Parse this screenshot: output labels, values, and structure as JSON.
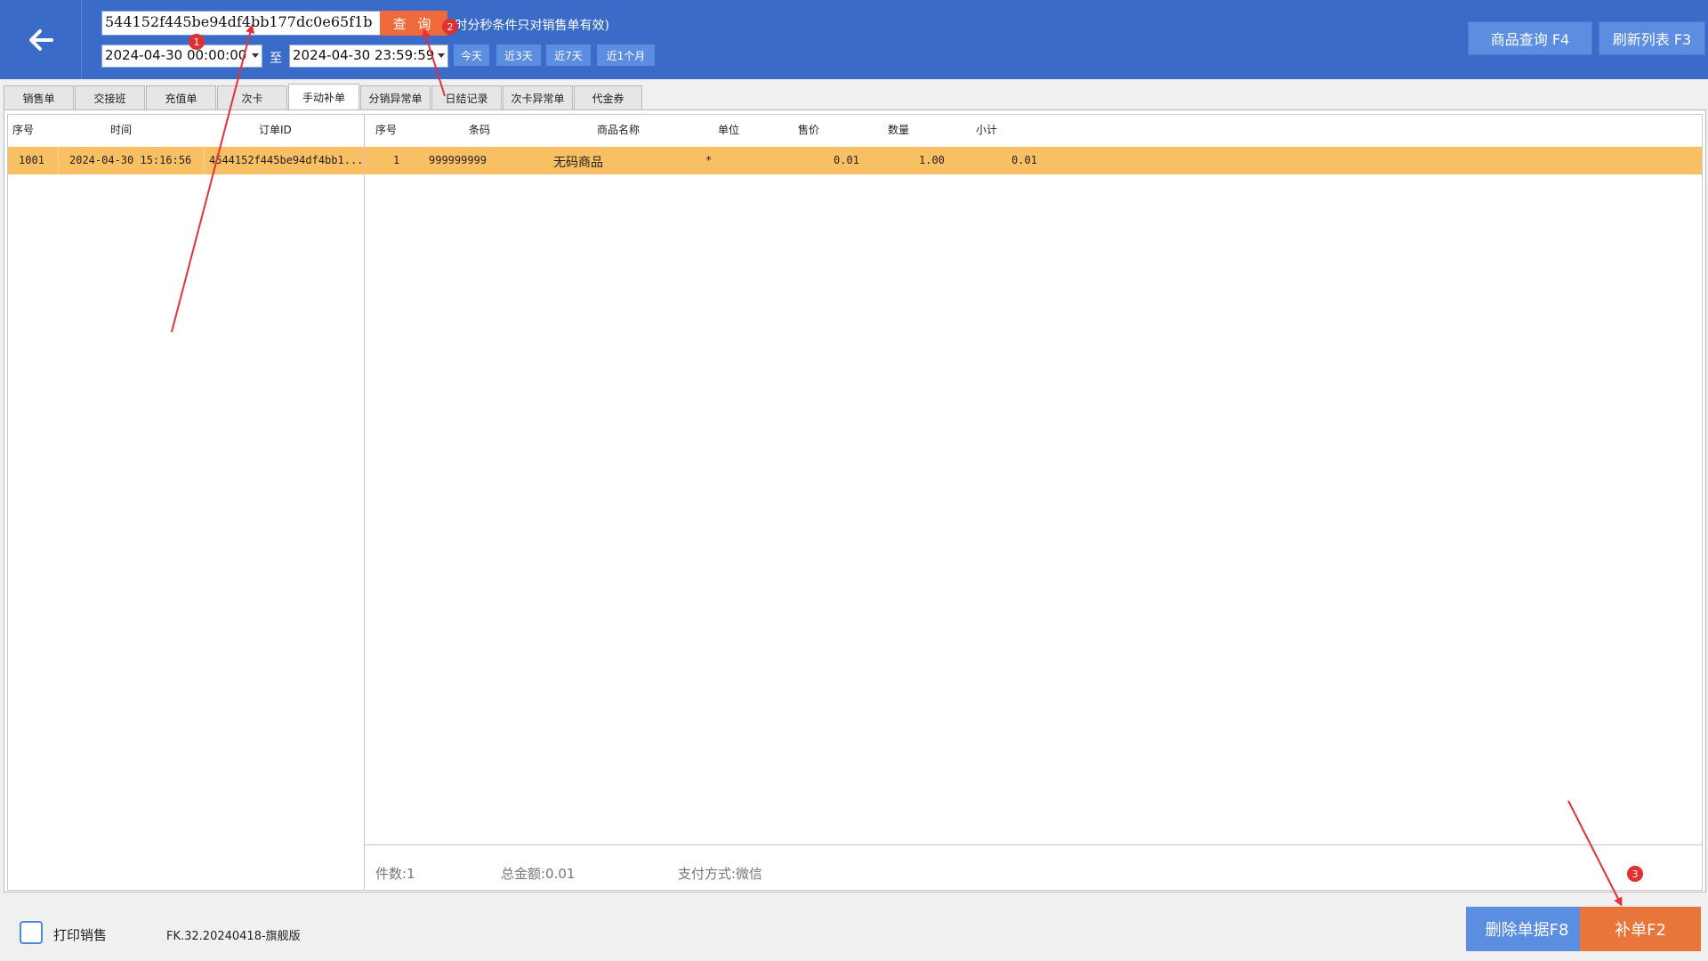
{
  "header": {
    "search_value": "544152f445be94df4bb177dc0e65f1b",
    "query_label": "查 询",
    "query_note": "(时分秒条件只对销售单有效)",
    "date_from": "2024-04-30 00:00:00",
    "date_sep": "至",
    "date_to": "2024-04-30 23:59:59",
    "quick_today": "今天",
    "quick_3d": "近3天",
    "quick_7d": "近7天",
    "quick_1m": "近1个月",
    "product_query": "商品查询 F4",
    "refresh_list": "刷新列表 F3"
  },
  "tabs": [
    {
      "label": "销售单"
    },
    {
      "label": "交接班"
    },
    {
      "label": "充值单"
    },
    {
      "label": "次卡"
    },
    {
      "label": "手动补单"
    },
    {
      "label": "分销异常单"
    },
    {
      "label": "日结记录"
    },
    {
      "label": "次卡异常单"
    },
    {
      "label": "代金券"
    }
  ],
  "orders": {
    "columns": [
      "序号",
      "时间",
      "订单ID"
    ],
    "rows": [
      {
        "seq": "1001",
        "time": "2024-04-30 15:16:56",
        "order_id": "4544152f445be94df4bb1..."
      }
    ]
  },
  "items": {
    "columns": [
      "序号",
      "条码",
      "商品名称",
      "单位",
      "售价",
      "数量",
      "小计"
    ],
    "rows": [
      {
        "seq": "1",
        "barcode": "999999999",
        "name": "无码商品",
        "unit": "*",
        "price": "0.01",
        "qty": "1.00",
        "subtotal": "0.01"
      }
    ],
    "footer": {
      "count": "件数:1",
      "total": "总金额:0.01",
      "payment": "支付方式:微信"
    }
  },
  "bottom": {
    "print_label": "打印销售",
    "version": "FK.32.20240418-旗舰版",
    "delete_label": "删除单据F8",
    "supplement_label": "补单F2"
  },
  "annotations": {
    "badge_1": "1",
    "badge_2": "2",
    "badge_3": "3"
  }
}
